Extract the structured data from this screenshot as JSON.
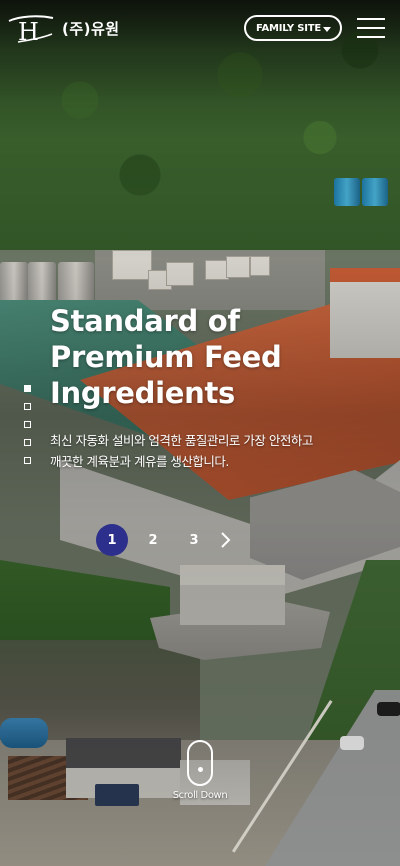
{
  "header": {
    "logo_letter": "H",
    "brand_name": "(주)유원",
    "family_site_label": "FAMILY SITE",
    "menu_icon": "hamburger-menu-icon"
  },
  "hero": {
    "title_lines": [
      "Standard of",
      "Premium Feed",
      "Ingredients"
    ],
    "description_lines": [
      "최신 자동화 설비와 엄격한 품질관리로 가장 안전하고",
      "깨끗한 계육분과 계유를 생산합니다."
    ],
    "background": "aerial-factory-photo"
  },
  "side_indicator": {
    "count": 5,
    "active_index": 0
  },
  "pagination": {
    "pages": [
      "1",
      "2",
      "3"
    ],
    "active_page": "1",
    "next_icon": "chevron-right-icon",
    "accent_color": "#2d2f8c"
  },
  "scroll": {
    "label": "Scroll Down",
    "icon": "mouse-scroll-icon"
  }
}
